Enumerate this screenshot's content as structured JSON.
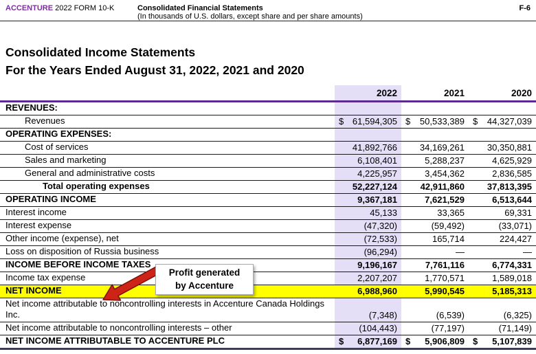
{
  "header": {
    "brand": "ACCENTURE",
    "form": "2022 FORM 10-K",
    "doc_title": "Consolidated Financial Statements",
    "doc_subtitle": "(In thousands of U.S. dollars, except share and per share amounts)",
    "page_ref": "F-6"
  },
  "title": {
    "line1": "Consolidated Income Statements",
    "line2": "For the Years Ended August 31, 2022, 2021 and 2020"
  },
  "annotation": {
    "line1": "Profit generated",
    "line2": "by Accenture"
  },
  "colors": {
    "brand_purple": "#7B2EA0",
    "header_rule_purple": "#5C2B91",
    "column_highlight_lavender": "#E4DFF7",
    "net_income_highlight_yellow": "#FFFF00",
    "arrow_red": "#CE2418",
    "arrow_outline_dark_red": "#7A1208"
  },
  "table": {
    "year_headers": [
      "2022",
      "2021",
      "2020"
    ],
    "rows": [
      {
        "label": "REVENUES:",
        "style": "section",
        "dollar": false,
        "values": [
          "",
          "",
          ""
        ]
      },
      {
        "label": "Revenues",
        "style": "indent",
        "dollar": true,
        "values": [
          "61,594,305",
          "50,533,389",
          "44,327,039"
        ]
      },
      {
        "label": "OPERATING EXPENSES:",
        "style": "section",
        "dollar": false,
        "values": [
          "",
          "",
          ""
        ]
      },
      {
        "label": "Cost of services",
        "style": "indent",
        "dollar": false,
        "values": [
          "41,892,766",
          "34,169,261",
          "30,350,881"
        ]
      },
      {
        "label": "Sales and marketing",
        "style": "indent",
        "dollar": false,
        "values": [
          "6,108,401",
          "5,288,237",
          "4,625,929"
        ]
      },
      {
        "label": "General and administrative costs",
        "style": "indent",
        "dollar": false,
        "values": [
          "4,225,957",
          "3,454,362",
          "2,836,585"
        ]
      },
      {
        "label": "Total operating expenses",
        "style": "total",
        "dollar": false,
        "values": [
          "52,227,124",
          "42,911,860",
          "37,813,395"
        ]
      },
      {
        "label": "OPERATING INCOME",
        "style": "section",
        "dollar": false,
        "values": [
          "9,367,181",
          "7,621,529",
          "6,513,644"
        ]
      },
      {
        "label": "Interest income",
        "style": "plain",
        "dollar": false,
        "values": [
          "45,133",
          "33,365",
          "69,331"
        ]
      },
      {
        "label": "Interest expense",
        "style": "plain",
        "dollar": false,
        "values": [
          "(47,320)",
          "(59,492)",
          "(33,071)"
        ]
      },
      {
        "label": "Other income (expense), net",
        "style": "plain",
        "dollar": false,
        "values": [
          "(72,533)",
          "165,714",
          "224,427"
        ]
      },
      {
        "label": "Loss on disposition of Russia business",
        "style": "plain",
        "dollar": false,
        "values": [
          "(96,294)",
          "—",
          "—"
        ]
      },
      {
        "label": "INCOME BEFORE INCOME TAXES",
        "style": "section",
        "dollar": false,
        "values": [
          "9,196,167",
          "7,761,116",
          "6,774,331"
        ]
      },
      {
        "label": "Income tax expense",
        "style": "plain",
        "dollar": false,
        "values": [
          "2,207,207",
          "1,770,571",
          "1,589,018"
        ]
      },
      {
        "label": "NET INCOME",
        "style": "section",
        "highlight": true,
        "dollar": false,
        "values": [
          "6,988,960",
          "5,990,545",
          "5,185,313"
        ]
      },
      {
        "label": "Net income attributable to noncontrolling interests in Accenture Canada Holdings Inc.",
        "style": "plain",
        "dollar": false,
        "values": [
          "(7,348)",
          "(6,539)",
          "(6,325)"
        ]
      },
      {
        "label": "Net income attributable to noncontrolling interests – other",
        "style": "plain",
        "dollar": false,
        "values": [
          "(104,443)",
          "(77,197)",
          "(71,149)"
        ]
      },
      {
        "label": "NET INCOME ATTRIBUTABLE TO ACCENTURE PLC",
        "style": "section",
        "final": true,
        "dollar": true,
        "values": [
          "6,877,169",
          "5,906,809",
          "5,107,839"
        ]
      }
    ]
  }
}
